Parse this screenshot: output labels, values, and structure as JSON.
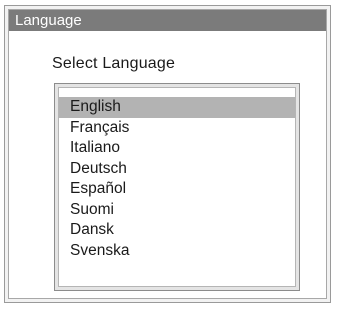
{
  "window": {
    "title": "Language"
  },
  "prompt": "Select  Language",
  "language_list": {
    "selected_index": 0,
    "items": [
      "English",
      "Français",
      "Italiano",
      "Deutsch",
      "Español",
      "Suomi",
      "Dansk",
      "Svenska"
    ]
  },
  "colors": {
    "title_bar": "#7b7b7b",
    "title_text": "#ffffff",
    "selection_highlight": "#b3b3b3"
  }
}
